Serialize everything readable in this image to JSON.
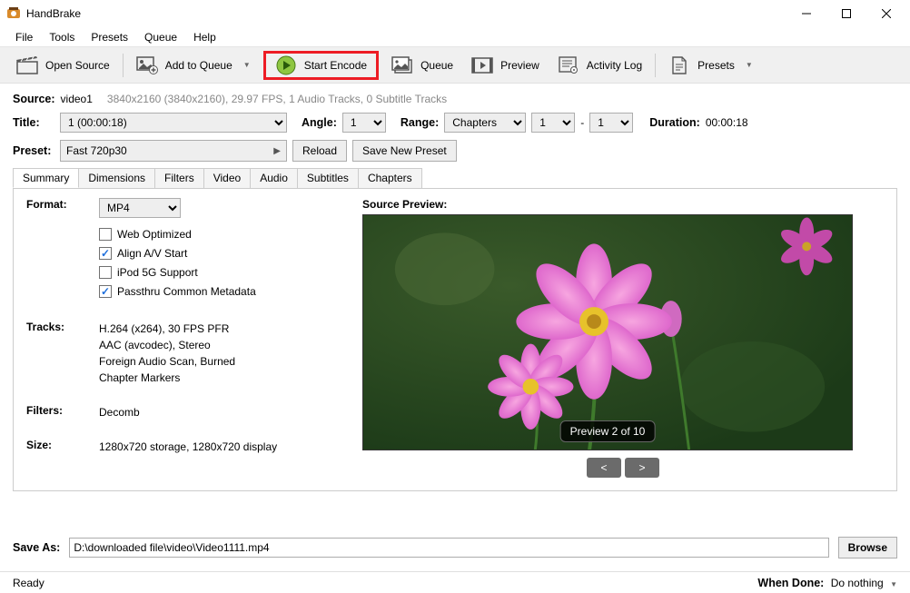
{
  "window": {
    "title": "HandBrake"
  },
  "menus": [
    "File",
    "Tools",
    "Presets",
    "Queue",
    "Help"
  ],
  "toolbar": {
    "open_source": "Open Source",
    "add_to_queue": "Add to Queue",
    "start_encode": "Start Encode",
    "queue": "Queue",
    "preview": "Preview",
    "activity_log": "Activity Log",
    "presets": "Presets"
  },
  "source": {
    "label": "Source:",
    "name": "video1",
    "meta": "3840x2160 (3840x2160), 29.97 FPS, 1 Audio Tracks, 0 Subtitle Tracks"
  },
  "title": {
    "label": "Title:",
    "value": "1  (00:00:18)",
    "angle_label": "Angle:",
    "angle": "1",
    "range_label": "Range:",
    "range_type": "Chapters",
    "from": "1",
    "dash": "-",
    "to": "1",
    "duration_label": "Duration:",
    "duration": "00:00:18"
  },
  "preset": {
    "label": "Preset:",
    "value": "Fast 720p30",
    "reload": "Reload",
    "save_new": "Save New Preset"
  },
  "tabs": [
    "Summary",
    "Dimensions",
    "Filters",
    "Video",
    "Audio",
    "Subtitles",
    "Chapters"
  ],
  "summary": {
    "format_label": "Format:",
    "format": "MP4",
    "opts": {
      "web": "Web Optimized",
      "align": "Align A/V Start",
      "ipod": "iPod 5G Support",
      "meta": "Passthru Common Metadata"
    },
    "tracks_label": "Tracks:",
    "tracks": "H.264 (x264), 30 FPS PFR\nAAC (avcodec), Stereo\nForeign Audio Scan, Burned\nChapter Markers",
    "filters_label": "Filters:",
    "filters": "Decomb",
    "size_label": "Size:",
    "size": "1280x720 storage, 1280x720 display",
    "preview_label": "Source Preview:",
    "preview_caption": "Preview 2 of 10",
    "prev": "<",
    "next": ">"
  },
  "save_as": {
    "label": "Save As:",
    "path": "D:\\downloaded file\\video\\Video1111.mp4",
    "browse": "Browse"
  },
  "status": {
    "ready": "Ready",
    "when_done_label": "When Done:",
    "when_done": "Do nothing"
  }
}
